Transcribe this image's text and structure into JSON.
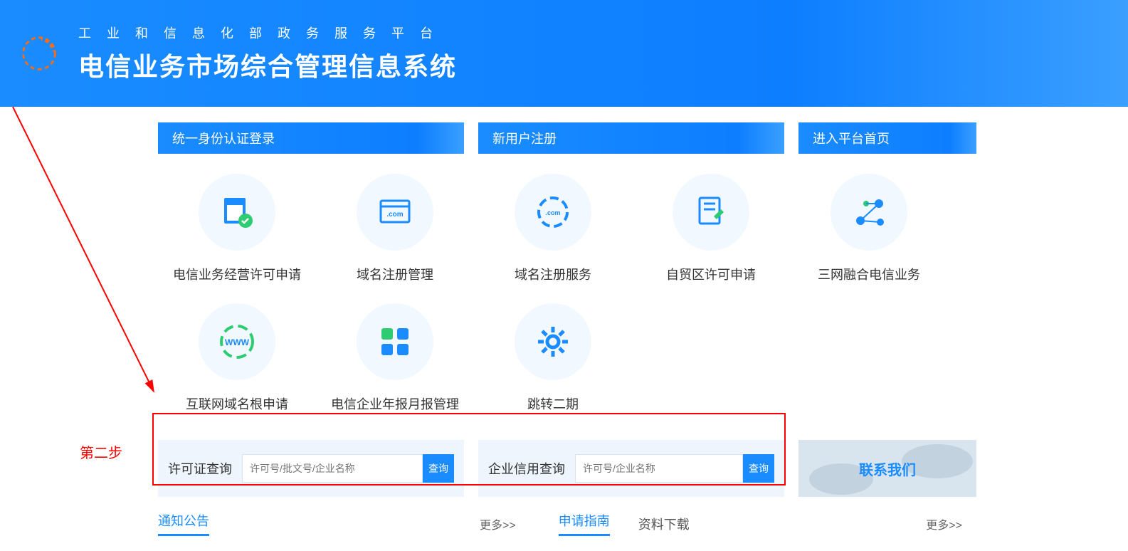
{
  "header": {
    "subtitle": "工业和信息化部政务服务平台",
    "title": "电信业务市场综合管理信息系统"
  },
  "topButtons": {
    "login": "统一身份认证登录",
    "register": "新用户注册",
    "home": "进入平台首页"
  },
  "services": {
    "row1": [
      {
        "label": "电信业务经营许可申请"
      },
      {
        "label": "域名注册管理"
      },
      {
        "label": "域名注册服务"
      },
      {
        "label": "自贸区许可申请"
      },
      {
        "label": "三网融合电信业务"
      }
    ],
    "row2": [
      {
        "label": "互联网域名根申请"
      },
      {
        "label": "电信企业年报月报管理"
      },
      {
        "label": "跳转二期"
      }
    ]
  },
  "annotation": {
    "label": "第二步"
  },
  "query": {
    "license": {
      "title": "许可证查询",
      "placeholder": "许可号/批文号/企业名称",
      "button": "查询"
    },
    "credit": {
      "title": "企业信用查询",
      "placeholder": "许可号/企业名称",
      "button": "查询"
    }
  },
  "contact": {
    "label": "联系我们"
  },
  "tabs": {
    "notice": "通知公告",
    "more1": "更多>>",
    "guide": "申请指南",
    "download": "资料下载",
    "more2": "更多>>"
  }
}
